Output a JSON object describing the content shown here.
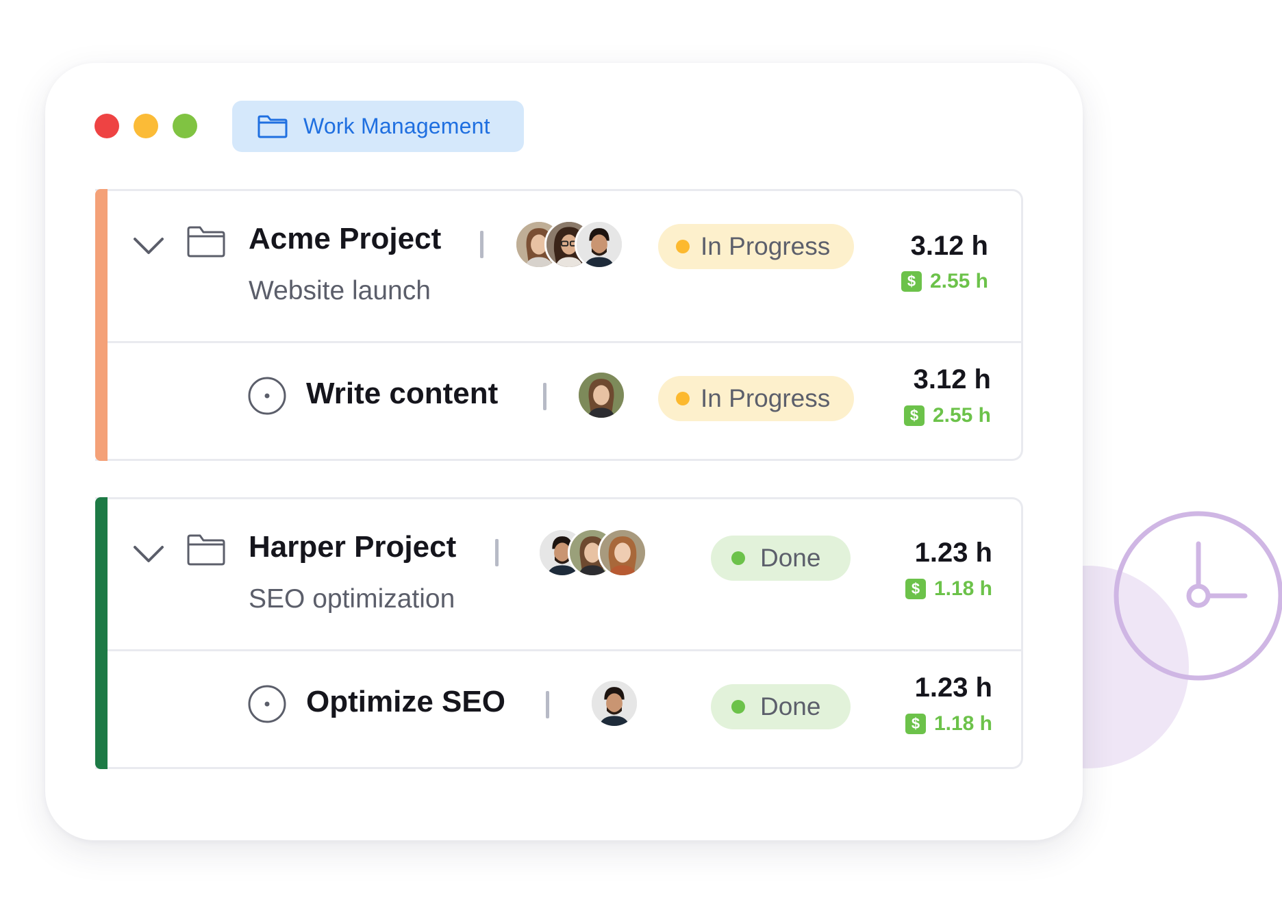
{
  "window": {
    "controls": [
      {
        "name": "close",
        "color": "#ee4343"
      },
      {
        "name": "minimize",
        "color": "#fbbb37"
      },
      {
        "name": "maximize",
        "color": "#80c342"
      }
    ]
  },
  "workspace": {
    "label": "Work Management",
    "icon": "folder-icon",
    "color": "#1f6fe0"
  },
  "groups": [
    {
      "accent_color": "#f4a178",
      "project": {
        "title": "Acme Project",
        "subtitle": "Website launch",
        "status": "In Progress",
        "hours": "3.12 h",
        "billable": "2.55 h"
      },
      "task": {
        "title": "Write content",
        "status": "In Progress",
        "hours": "3.12 h",
        "billable": "2.55 h"
      }
    },
    {
      "accent_color": "#1d7a45",
      "project": {
        "title": "Harper Project",
        "subtitle": "SEO optimization",
        "status": "Done",
        "hours": "1.23 h",
        "billable": "1.18 h"
      },
      "task": {
        "title": "Optimize SEO",
        "status": "Done",
        "hours": "1.23 h",
        "billable": "1.18 h"
      }
    }
  ],
  "icons": {
    "billable": "dollar-icon",
    "billable_symbol": "$",
    "expand": "chevron-down-icon",
    "task": "task-circle-icon",
    "decoration": "clock-icon"
  },
  "status_colors": {
    "in_progress": "#fcb92f",
    "done": "#6cc24a"
  }
}
